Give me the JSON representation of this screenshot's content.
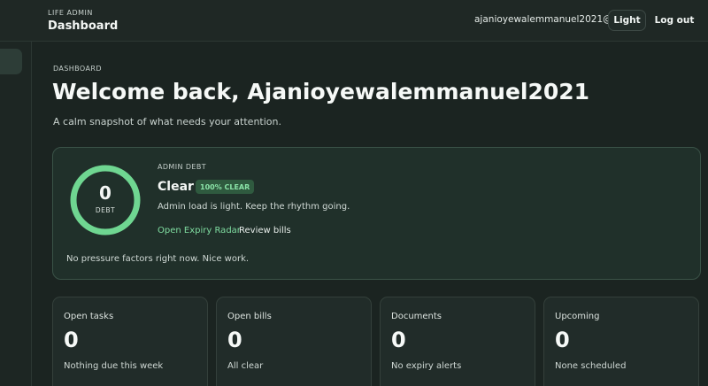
{
  "header": {
    "eyebrow": "LIFE ADMIN",
    "title": "Dashboard",
    "user_email": "ajanioyewalemmanuel2021@...",
    "theme_toggle_label": "Light",
    "logout_label": "Log out"
  },
  "page": {
    "eyebrow": "DASHBOARD",
    "welcome": "Welcome back, Ajanioyewalemmanuel2021",
    "tagline": "A calm snapshot of what needs your attention."
  },
  "admin_debt": {
    "eyebrow": "ADMIN DEBT",
    "gauge_value": "0",
    "gauge_label": "DEBT",
    "gauge_fill_percent": 100,
    "status": "Clear",
    "badge": "100% CLEAR",
    "description": "Admin load is light. Keep the rhythm going.",
    "primary_link": "Open Expiry Radar",
    "secondary_link": "Review bills",
    "note": "No pressure factors right now. Nice work."
  },
  "stats": [
    {
      "label": "Open tasks",
      "value": "0",
      "sub": "Nothing due this week"
    },
    {
      "label": "Open bills",
      "value": "0",
      "sub": "All clear"
    },
    {
      "label": "Documents",
      "value": "0",
      "sub": "No expiry alerts"
    },
    {
      "label": "Upcoming",
      "value": "0",
      "sub": "None scheduled"
    }
  ],
  "colors": {
    "background": "#1b2421",
    "accent_green": "#6fd691",
    "card_border": "#3a5247"
  }
}
